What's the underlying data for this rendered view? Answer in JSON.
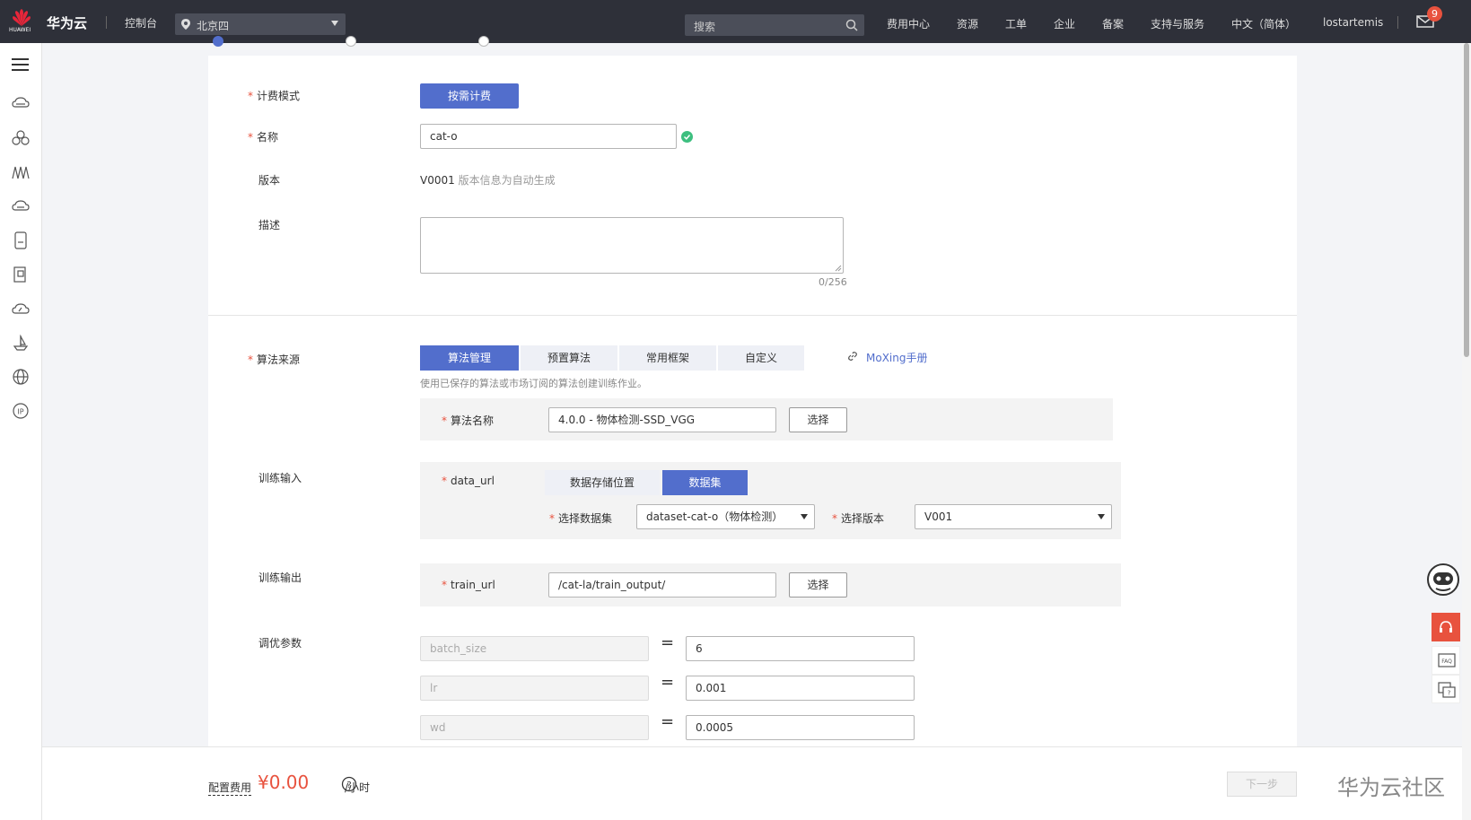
{
  "topbar": {
    "brand": "华为云",
    "logo_text": "HUAWEI",
    "console": "控制台",
    "region": "北京四",
    "search_placeholder": "搜索",
    "nav": [
      "费用中心",
      "资源",
      "工单",
      "企业",
      "备案",
      "支持与服务",
      "中文（简体）",
      "lostartemis"
    ],
    "mail_badge": "9"
  },
  "sidebar": {
    "icons": [
      "cloud-server-icon",
      "cluster-icon",
      "bandwidth-icon",
      "cloud-disk-icon",
      "storage-icon",
      "document-icon",
      "cloud-icon",
      "ship-icon",
      "globe-icon",
      "ip-icon"
    ]
  },
  "form": {
    "billing_label": "计费模式",
    "billing_value": "按需计费",
    "name_label": "名称",
    "name_value": "cat-o",
    "version_label": "版本",
    "version_value": "V0001",
    "version_hint": "版本信息为自动生成",
    "desc_label": "描述",
    "desc_counter": "0/256",
    "algo_label": "算法来源",
    "algo_tabs": [
      "算法管理",
      "预置算法",
      "常用框架",
      "自定义"
    ],
    "moxing_link": "MoXing手册",
    "algo_hint": "使用已保存的算法或市场订阅的算法创建训练作业。",
    "algo_name_label": "算法名称",
    "algo_name_value": "4.0.0 - 物体检测-SSD_VGG",
    "select_button": "选择",
    "train_input_label": "训练输入",
    "data_url_label": "data_url",
    "data_tabs": [
      "数据存储位置",
      "数据集"
    ],
    "select_dataset_label": "选择数据集",
    "dataset_value": "dataset-cat-o（物体检测）",
    "select_version_label": "选择版本",
    "version_select_value": "V001",
    "train_output_label": "训练输出",
    "train_url_label": "train_url",
    "train_url_value": "/cat-la/train_output/",
    "tuning_label": "调优参数",
    "params": [
      {
        "key": "batch_size",
        "value": "6"
      },
      {
        "key": "lr",
        "value": "0.001"
      },
      {
        "key": "wd",
        "value": "0.0005"
      }
    ],
    "eq": "="
  },
  "footer": {
    "fee_label": "配置费用",
    "fee_value": "¥0.00",
    "fee_unit": "/小时",
    "next_button": "下一步",
    "watermark": "华为云社区"
  },
  "colors": {
    "primary": "#526ecc",
    "danger": "#e8523e",
    "topbar": "#2e3039",
    "success": "#3dbf7f"
  }
}
